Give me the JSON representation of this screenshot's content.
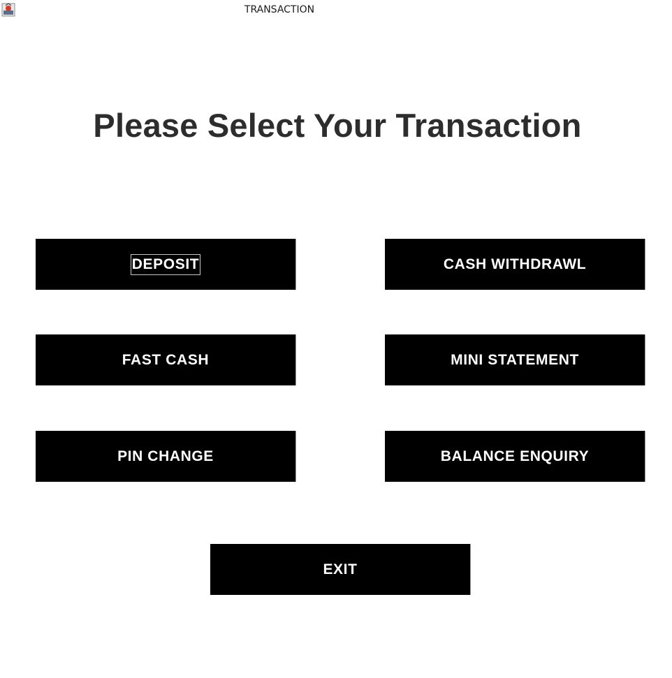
{
  "window": {
    "title": "TRANSACTION"
  },
  "heading": "Please Select Your Transaction",
  "buttons": {
    "deposit": "DEPOSIT",
    "cash_withdrawl": "CASH WITHDRAWL",
    "fast_cash": "FAST CASH",
    "mini_statement": "MINI STATEMENT",
    "pin_change": "PIN CHANGE",
    "balance_enquiry": "BALANCE ENQUIRY",
    "exit": "EXIT"
  },
  "focused_button": "deposit",
  "colors": {
    "background": "#ffffff",
    "button_fill": "#000000",
    "button_text": "#ffffff",
    "heading_text": "#2d2d2d"
  },
  "icons": {
    "app": "java-app-icon"
  }
}
